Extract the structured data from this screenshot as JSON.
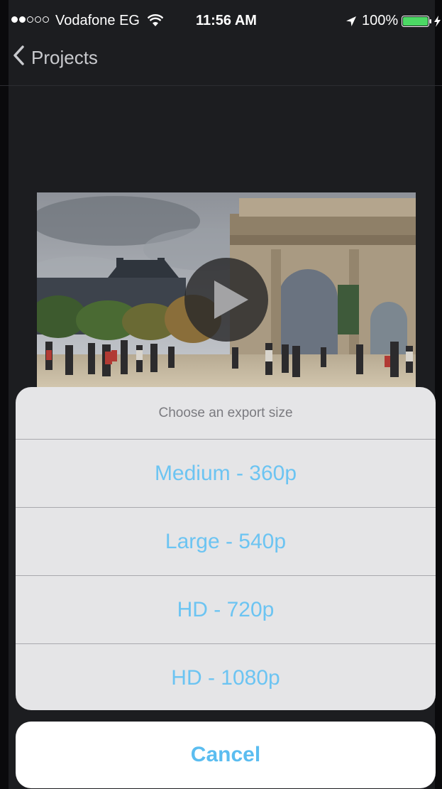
{
  "status_bar": {
    "signal_filled": 2,
    "signal_total": 5,
    "carrier": "Vodafone EG",
    "time": "11:56 AM",
    "battery_percent_label": "100%",
    "battery_level": 1.0
  },
  "nav": {
    "back_label": "Projects"
  },
  "video": {
    "play_icon": "play-icon"
  },
  "export_sheet": {
    "title": "Choose an export size",
    "options": [
      "Medium - 360p",
      "Large - 540p",
      "HD - 720p",
      "HD - 1080p"
    ],
    "cancel_label": "Cancel"
  },
  "colors": {
    "accent_blue": "#6cc4f2",
    "battery_green": "#4cd964",
    "background": "#1c1d20"
  }
}
